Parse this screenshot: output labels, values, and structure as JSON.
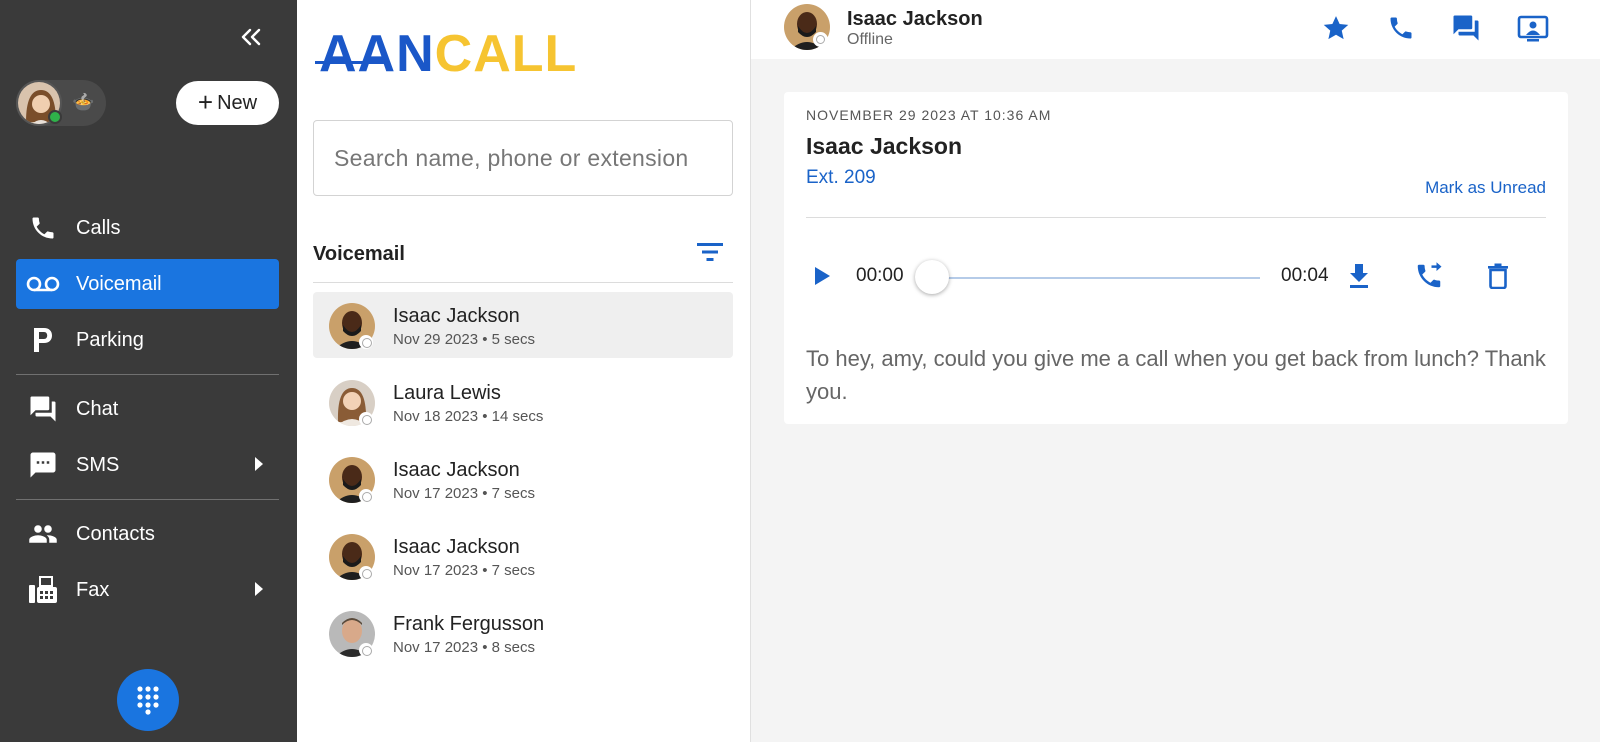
{
  "sidebar": {
    "new_label": "New",
    "user_emoji": "🍲",
    "items": [
      {
        "label": "Calls",
        "icon": "phone-icon"
      },
      {
        "label": "Voicemail",
        "icon": "voicemail-icon"
      },
      {
        "label": "Parking",
        "icon": "parking-icon"
      },
      {
        "label": "Chat",
        "icon": "chat-icon"
      },
      {
        "label": "SMS",
        "icon": "sms-icon"
      },
      {
        "label": "Contacts",
        "icon": "contacts-icon"
      },
      {
        "label": "Fax",
        "icon": "fax-icon"
      }
    ],
    "active_item": "Voicemail",
    "accent_color": "#1a75e0"
  },
  "logo": {
    "part1": "AAN",
    "part2": "CALL"
  },
  "search": {
    "placeholder": "Search name, phone or extension",
    "value": ""
  },
  "voicemail_list": {
    "title": "Voicemail",
    "items": [
      {
        "name": "Isaac Jackson",
        "meta": "Nov 29 2023 • 5 secs",
        "selected": true
      },
      {
        "name": "Laura Lewis",
        "meta": "Nov 18 2023 • 14 secs",
        "selected": false
      },
      {
        "name": "Isaac Jackson",
        "meta": "Nov 17 2023 • 7 secs",
        "selected": false
      },
      {
        "name": "Isaac Jackson",
        "meta": "Nov 17 2023 • 7 secs",
        "selected": false
      },
      {
        "name": "Frank Fergusson",
        "meta": "Nov 17 2023 • 8 secs",
        "selected": false
      }
    ]
  },
  "header": {
    "name": "Isaac Jackson",
    "status": "Offline"
  },
  "detail": {
    "date": "NOVEMBER 29 2023 AT 10:36 AM",
    "name": "Isaac Jackson",
    "ext": "Ext. 209",
    "mark_unread": "Mark as Unread",
    "time_current": "00:00",
    "time_total": "00:04",
    "progress": 0,
    "transcript": "To hey, amy, could you give me a call when you get back from lunch? Thank you."
  }
}
